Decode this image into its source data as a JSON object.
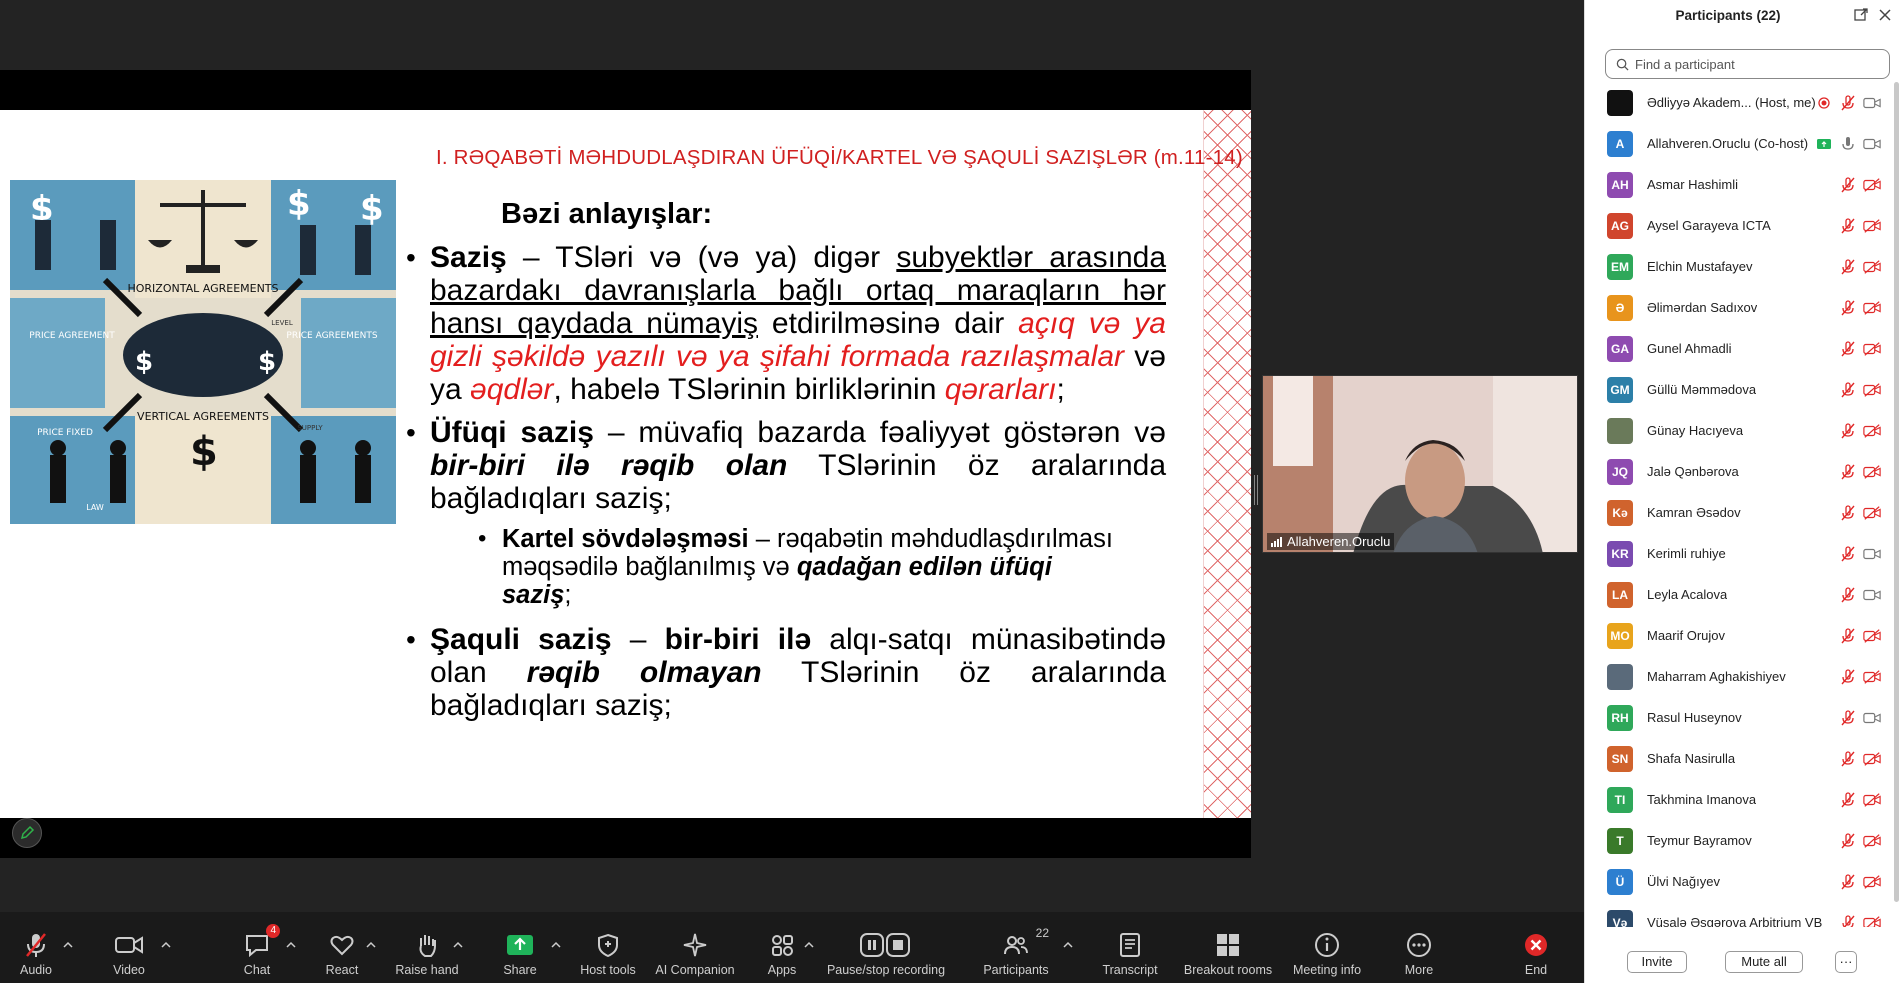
{
  "slide": {
    "header": "I. RƏQABƏTİ MƏHDUDLAŞDIRAN ÜFÜQİ/KARTEL VƏ ŞAQULİ SAZIŞLƏR (m.11-14)",
    "subtitle": "Bəzi anlayışlar:",
    "illustration": {
      "labels": [
        "HORIZONTAL AGREEMENTS",
        "PRICE AGREEMENT",
        "PRICE AGREEMENTS",
        "LEVEL",
        "VERTICAL AGREEMENTS",
        "PRICE FIXED",
        "SUPPLY",
        "LAW"
      ]
    },
    "b1": {
      "term": "Saziş",
      "t1": " – TSləri və (və ya) digər ",
      "u1": "subyektlər arasında bazardakı davranışlarla bağlı ortaq maraqların hər hansı qaydada nümayiş",
      "t2": " etdirilməsinə dair ",
      "r1": "açıq və ya gizli şəkildə yazılı və ya şifahi formada razılaşmalar",
      "t3": " və ya ",
      "r2": "əqdlər",
      "t4": ", habelə TSlərinin birliklərinin ",
      "r3": "qərarları",
      "t5": ";"
    },
    "b2": {
      "term": "Üfüqi saziş",
      "t1": " – müvafiq bazarda fəaliyyət göstərən və ",
      "bi1": "bir-biri ilə rəqib olan",
      "t2": " TSlərinin öz aralarında bağladıqları saziş;"
    },
    "sub": {
      "term": "Kartel sövdələşməsi",
      "t1": " – rəqabətin məhdudlaşdırılması məqsədilə bağlanılmış və ",
      "bi1": "qadağan edilən üfüqi saziş",
      "t2": ";"
    },
    "b3": {
      "term": "Şaquli saziş",
      "t1": " – ",
      "b1": "bir-biri ilə",
      "t2": " alqı-satqı münasibətində olan ",
      "bi1": "rəqib olmayan",
      "t3": " TSlərinin öz aralarında bağladıqları saziş;"
    }
  },
  "video": {
    "name": "Allahveren.Oruclu"
  },
  "panel": {
    "title": "Participants (22)",
    "search_placeholder": "Find a participant",
    "invite": "Invite",
    "mute_all": "Mute all",
    "more": "···",
    "participants": [
      {
        "initials": "",
        "name": "Ədliyyə Akadem... (Host, me)",
        "color": "#111111",
        "status": "host"
      },
      {
        "initials": "A",
        "name": "Allahveren.Oruclu (Co-host)",
        "color": "#2d7fd0",
        "status": "cohost"
      },
      {
        "initials": "AH",
        "name": "Asmar Hashimli",
        "color": "#8e4bb0",
        "status": "muted"
      },
      {
        "initials": "AG",
        "name": "Aysel Garayeva ICTA",
        "color": "#d0452d",
        "status": "muted"
      },
      {
        "initials": "EM",
        "name": "Elchin Mustafayev",
        "color": "#2fa85a",
        "status": "muted"
      },
      {
        "initials": "Ə",
        "name": "Əlimərdan Sadıxov",
        "color": "#e8941c",
        "status": "muted"
      },
      {
        "initials": "GA",
        "name": "Gunel Ahmadli",
        "color": "#8e4bb0",
        "status": "muted"
      },
      {
        "initials": "GM",
        "name": "Güllü Məmmədova",
        "color": "#2c7fa8",
        "status": "muted"
      },
      {
        "initials": "",
        "name": "Günay Hacıyeva",
        "color": "#6a7a5a",
        "status": "muted"
      },
      {
        "initials": "JQ",
        "name": "Jalə Qənbərova",
        "color": "#8e4bb0",
        "status": "muted"
      },
      {
        "initials": "Kə",
        "name": "Kamran Əsədov",
        "color": "#d0632d",
        "status": "muted"
      },
      {
        "initials": "KR",
        "name": "Kerimli ruhiye",
        "color": "#7a4bb0",
        "status": "mutednovid"
      },
      {
        "initials": "LA",
        "name": "Leyla Acalova",
        "color": "#d0632d",
        "status": "mutednovid"
      },
      {
        "initials": "MO",
        "name": "Maarif Orujov",
        "color": "#e8a41c",
        "status": "muted"
      },
      {
        "initials": "",
        "name": "Maharram Aghakishiyev",
        "color": "#5a6a7a",
        "status": "muted"
      },
      {
        "initials": "RH",
        "name": "Rasul Huseynov",
        "color": "#2fa85a",
        "status": "mutednovid"
      },
      {
        "initials": "SN",
        "name": "Shafa Nasirulla",
        "color": "#d0632d",
        "status": "muted"
      },
      {
        "initials": "TI",
        "name": "Takhmina Imanova",
        "color": "#2fa85a",
        "status": "muted"
      },
      {
        "initials": "T",
        "name": "Teymur Bayramov",
        "color": "#3a7a2a",
        "status": "muted"
      },
      {
        "initials": "Ü",
        "name": "Ülvi Nağıyev",
        "color": "#2d7fd0",
        "status": "muted"
      },
      {
        "initials": "Və",
        "name": "Vüsalə Əsgərova Arbitrium VB",
        "color": "#2c4a6a",
        "status": "muted"
      }
    ]
  },
  "toolbar": {
    "audio": "Audio",
    "video": "Video",
    "chat": "Chat",
    "chat_badge": "4",
    "react": "React",
    "raise_hand": "Raise hand",
    "share": "Share",
    "host_tools": "Host tools",
    "ai_companion": "AI Companion",
    "apps": "Apps",
    "pause_stop_recording": "Pause/stop recording",
    "participants": "Participants",
    "participants_count": "22",
    "transcript": "Transcript",
    "breakout_rooms": "Breakout rooms",
    "meeting_info": "Meeting info",
    "more": "More",
    "end": "End",
    "colors": {
      "share_green": "#1fb35a",
      "end_red": "#e02828"
    }
  }
}
